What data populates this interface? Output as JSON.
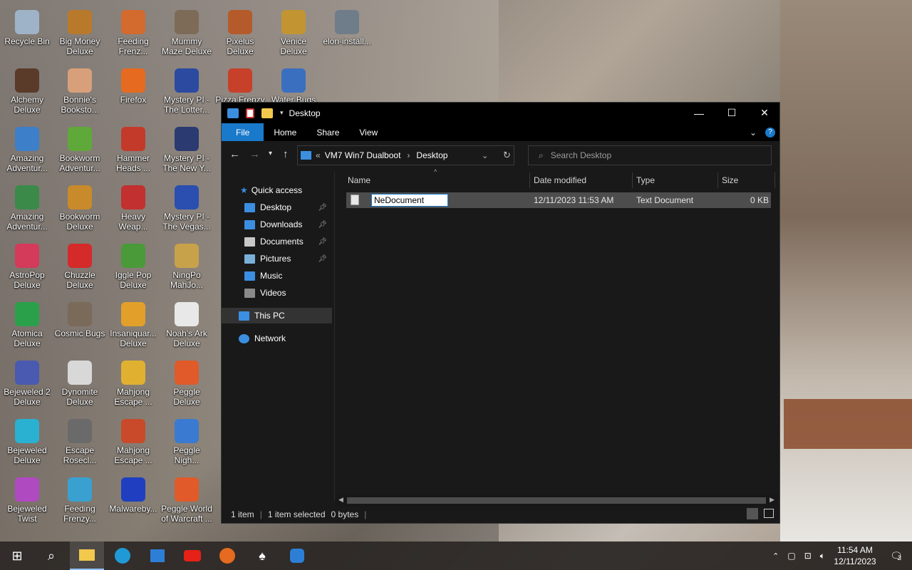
{
  "desktop": {
    "icons": [
      {
        "label": "Recycle Bin",
        "color": "#9fb3c8"
      },
      {
        "label": "Big Money\nDeluxe",
        "color": "#b87a2a"
      },
      {
        "label": "Feeding\nFrenz...",
        "color": "#d36a2e"
      },
      {
        "label": "Mummy\nMaze Deluxe",
        "color": "#7d6b58"
      },
      {
        "label": "Pixelus\nDeluxe",
        "color": "#b55a2a"
      },
      {
        "label": "Venice\nDeluxe",
        "color": "#c29532"
      },
      {
        "label": "elon-install...",
        "color": "#6f7c89"
      },
      {
        "label": "Alchemy\nDeluxe",
        "color": "#5a3b2a"
      },
      {
        "label": "Bonnie's\nBooksto...",
        "color": "#d8a07a"
      },
      {
        "label": "Firefox",
        "color": "#e66a1f"
      },
      {
        "label": "Mystery PI -\nThe Lotter...",
        "color": "#2b4aa0"
      },
      {
        "label": "Pizza Frenzy",
        "color": "#c7402a"
      },
      {
        "label": "Water Bugs",
        "color": "#3a6fc0"
      },
      {
        "label": "Amazing\nAdventur...",
        "color": "#3d7fc9"
      },
      {
        "label": "Bookworm\nAdventur...",
        "color": "#5fa83a"
      },
      {
        "label": "Hammer\nHeads ...",
        "color": "#c43a2a"
      },
      {
        "label": "Mystery PI -\nThe New Y...",
        "color": "#2b3a70"
      },
      {
        "label": "Amazing\nAdventur...",
        "color": "#3b8a4a"
      },
      {
        "label": "Bookworm\nDeluxe",
        "color": "#c88a2a"
      },
      {
        "label": "Heavy\nWeap...",
        "color": "#c23030"
      },
      {
        "label": "Mystery PI -\nThe Vegas...",
        "color": "#2a4fb0"
      },
      {
        "label": "AstroPop\nDeluxe",
        "color": "#d43a5a"
      },
      {
        "label": "Chuzzle\nDeluxe",
        "color": "#d42a2a"
      },
      {
        "label": "Iggle Pop\nDeluxe",
        "color": "#4a9a3a"
      },
      {
        "label": "NingPo\nMahJo...",
        "color": "#c8a24a"
      },
      {
        "label": "Atomica\nDeluxe",
        "color": "#2aa04a"
      },
      {
        "label": "Cosmic Bugs",
        "color": "#7a6a5a"
      },
      {
        "label": "Insaniquar...\nDeluxe",
        "color": "#e2a02a"
      },
      {
        "label": "Noah's Ark\nDeluxe",
        "color": "#e8e8e8"
      },
      {
        "label": "Bejeweled 2\nDeluxe",
        "color": "#4a5ab0"
      },
      {
        "label": "Dynomite\nDeluxe",
        "color": "#d8d8d8"
      },
      {
        "label": "Mahjong\nEscape ...",
        "color": "#e0b030"
      },
      {
        "label": "Peggle\nDeluxe",
        "color": "#e05a2a"
      },
      {
        "label": "Bejeweled\nDeluxe",
        "color": "#2ab0d0"
      },
      {
        "label": "Escape\nRosecl...",
        "color": "#6a6a6a"
      },
      {
        "label": "Mahjong\nEscape ...",
        "color": "#c84a2a"
      },
      {
        "label": "Peggle\nNigh...",
        "color": "#3a7ad0"
      },
      {
        "label": "Bejeweled\nTwist",
        "color": "#b04ac0"
      },
      {
        "label": "Feeding\nFrenzy...",
        "color": "#3aa0d0"
      },
      {
        "label": "Malwareby...",
        "color": "#1f3fc0"
      },
      {
        "label": "Peggle World\nof Warcraft ...",
        "color": "#e05a2a"
      }
    ]
  },
  "explorer": {
    "title": "Desktop",
    "ribbon": {
      "file": "File",
      "home": "Home",
      "share": "Share",
      "view": "View"
    },
    "address": {
      "root": "VM7 Win7 Dualboot",
      "current": "Desktop",
      "overflow": "«"
    },
    "search": {
      "placeholder": "Search Desktop"
    },
    "sidebar": {
      "quick_access": "Quick access",
      "items": [
        {
          "label": "Desktop",
          "color": "#3b8ee0",
          "pinned": true
        },
        {
          "label": "Downloads",
          "color": "#3b8ee0",
          "pinned": true
        },
        {
          "label": "Documents",
          "color": "#c8c8c8",
          "pinned": true
        },
        {
          "label": "Pictures",
          "color": "#7ab0d8",
          "pinned": true
        },
        {
          "label": "Music",
          "color": "#3b8ee0",
          "pinned": false
        },
        {
          "label": "Videos",
          "color": "#8a8a8a",
          "pinned": false
        }
      ],
      "this_pc": "This PC",
      "network": "Network"
    },
    "columns": {
      "name": "Name",
      "date": "Date modified",
      "type": "Type",
      "size": "Size"
    },
    "files": [
      {
        "name": "NeDocument",
        "date": "12/11/2023 11:53 AM",
        "type": "Text Document",
        "size": "0 KB"
      }
    ],
    "status": {
      "count": "1 item",
      "selected": "1 item selected",
      "bytes": "0 bytes"
    }
  },
  "taskbar": {
    "time": "11:54 AM",
    "date": "12/11/2023",
    "notifications": "3"
  }
}
